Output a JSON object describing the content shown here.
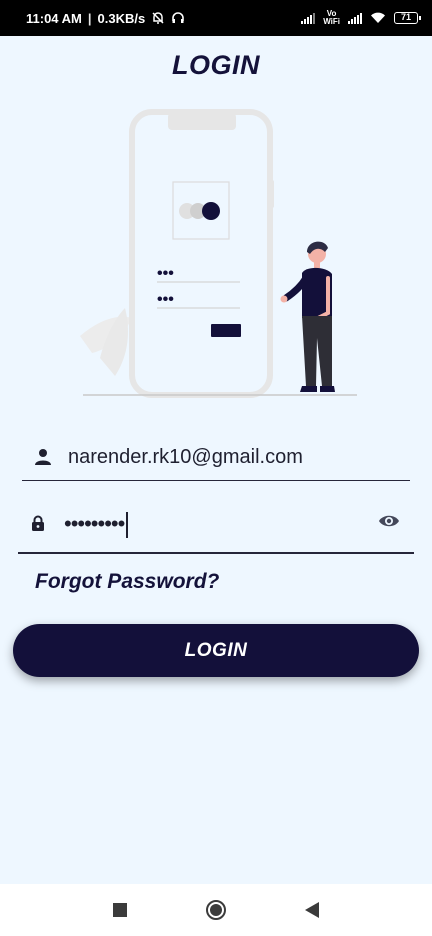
{
  "status_bar": {
    "time": "11:04 AM",
    "separator": "|",
    "speed": "0.3KB/s",
    "volte_top": "Vo",
    "volte_bottom": "WiFi",
    "battery": "71"
  },
  "header": {
    "title": "LOGIN"
  },
  "illustration": {
    "phone_color": "#e6e6e6",
    "accent_color": "#13103a",
    "password_dots": [
      "•••",
      "•••"
    ]
  },
  "form": {
    "email": {
      "value": "narender.rk10@gmail.com",
      "icon": "person-icon"
    },
    "password": {
      "value": "•••••••••",
      "icon": "lock-icon",
      "toggle_icon": "eye-icon"
    },
    "forgot_label": "Forgot Password?",
    "login_label": "LOGIN"
  },
  "nav_bar": {
    "icons": [
      "recents-square-icon",
      "home-circle-icon",
      "back-triangle-icon"
    ]
  },
  "colors": {
    "background": "#eef7ff",
    "primary": "#13103a"
  }
}
